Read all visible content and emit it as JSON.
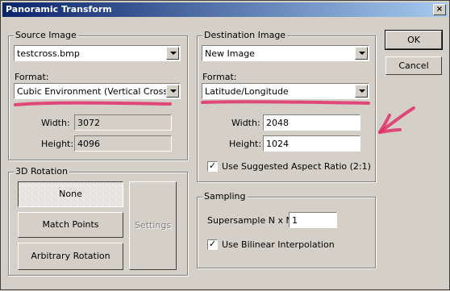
{
  "window": {
    "title": "Panoramic Transform"
  },
  "buttons": {
    "ok": "OK",
    "cancel": "Cancel"
  },
  "source": {
    "group_title": "Source Image",
    "image_value": "testcross.bmp",
    "format_label": "Format:",
    "format_value": "Cubic Environment (Vertical Cross)",
    "width_label": "Width:",
    "width_value": "3072",
    "height_label": "Height:",
    "height_value": "4096"
  },
  "destination": {
    "group_title": "Destination Image",
    "image_value": "New Image",
    "format_label": "Format:",
    "format_value": "Latitude/Longitude",
    "width_label": "Width:",
    "width_value": "2048",
    "height_label": "Height:",
    "height_value": "1024",
    "aspect_label": "Use Suggested Aspect Ratio (2:1)",
    "aspect_checked": true
  },
  "rotation": {
    "group_title": "3D Rotation",
    "none_label": "None",
    "match_label": "Match Points",
    "arbitrary_label": "Arbitrary Rotation",
    "settings_label": "Settings"
  },
  "sampling": {
    "group_title": "Sampling",
    "supersample_label": "Supersample N x N:",
    "supersample_value": "1",
    "bilinear_label": "Use Bilinear Interpolation",
    "bilinear_checked": true
  },
  "colors": {
    "annotation": "#e0306a",
    "titlebar": "#0a246a"
  }
}
